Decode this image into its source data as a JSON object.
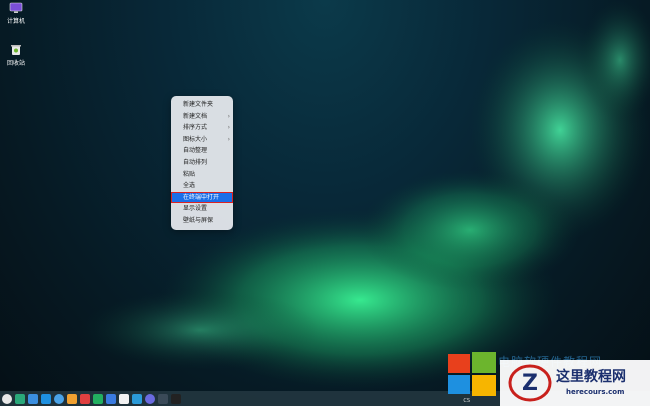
{
  "desktop": {
    "icons": [
      {
        "label": "计算机",
        "icon": "computer-icon"
      },
      {
        "label": "回收站",
        "icon": "trash-icon"
      }
    ]
  },
  "context_menu": {
    "items": [
      {
        "label": "新建文件夹",
        "has_submenu": false
      },
      {
        "label": "新建文档",
        "has_submenu": true
      },
      {
        "label": "排序方式",
        "has_submenu": true
      },
      {
        "label": "图标大小",
        "has_submenu": true
      },
      {
        "label": "自动整理",
        "has_submenu": false
      },
      {
        "label": "自动排列",
        "has_submenu": false
      },
      {
        "label": "粘贴",
        "has_submenu": false
      },
      {
        "label": "全选",
        "has_submenu": false
      },
      {
        "label": "在终端中打开",
        "has_submenu": false,
        "active": true
      },
      {
        "label": "显示设置",
        "has_submenu": false
      },
      {
        "label": "壁纸与屏保",
        "has_submenu": false
      }
    ],
    "submenu_arrow": "›"
  },
  "taskbar": {
    "icons": [
      "launcher-icon",
      "multitask-icon",
      "files-icon",
      "store-icon",
      "browser-icon",
      "photos-icon",
      "music-icon",
      "video-icon",
      "mail-icon",
      "calendar-icon",
      "contacts-icon",
      "settings-icon",
      "monitor-icon",
      "terminal-icon"
    ],
    "tray_text": "CS"
  },
  "watermark": {
    "title": "这里教程网",
    "url": "herecours.com",
    "blurred_text": "电脑软硬件教程网",
    "colors": {
      "red": "#e8401c",
      "green": "#6cb52d",
      "blue": "#1e90e0",
      "yellow": "#f7b500"
    }
  }
}
